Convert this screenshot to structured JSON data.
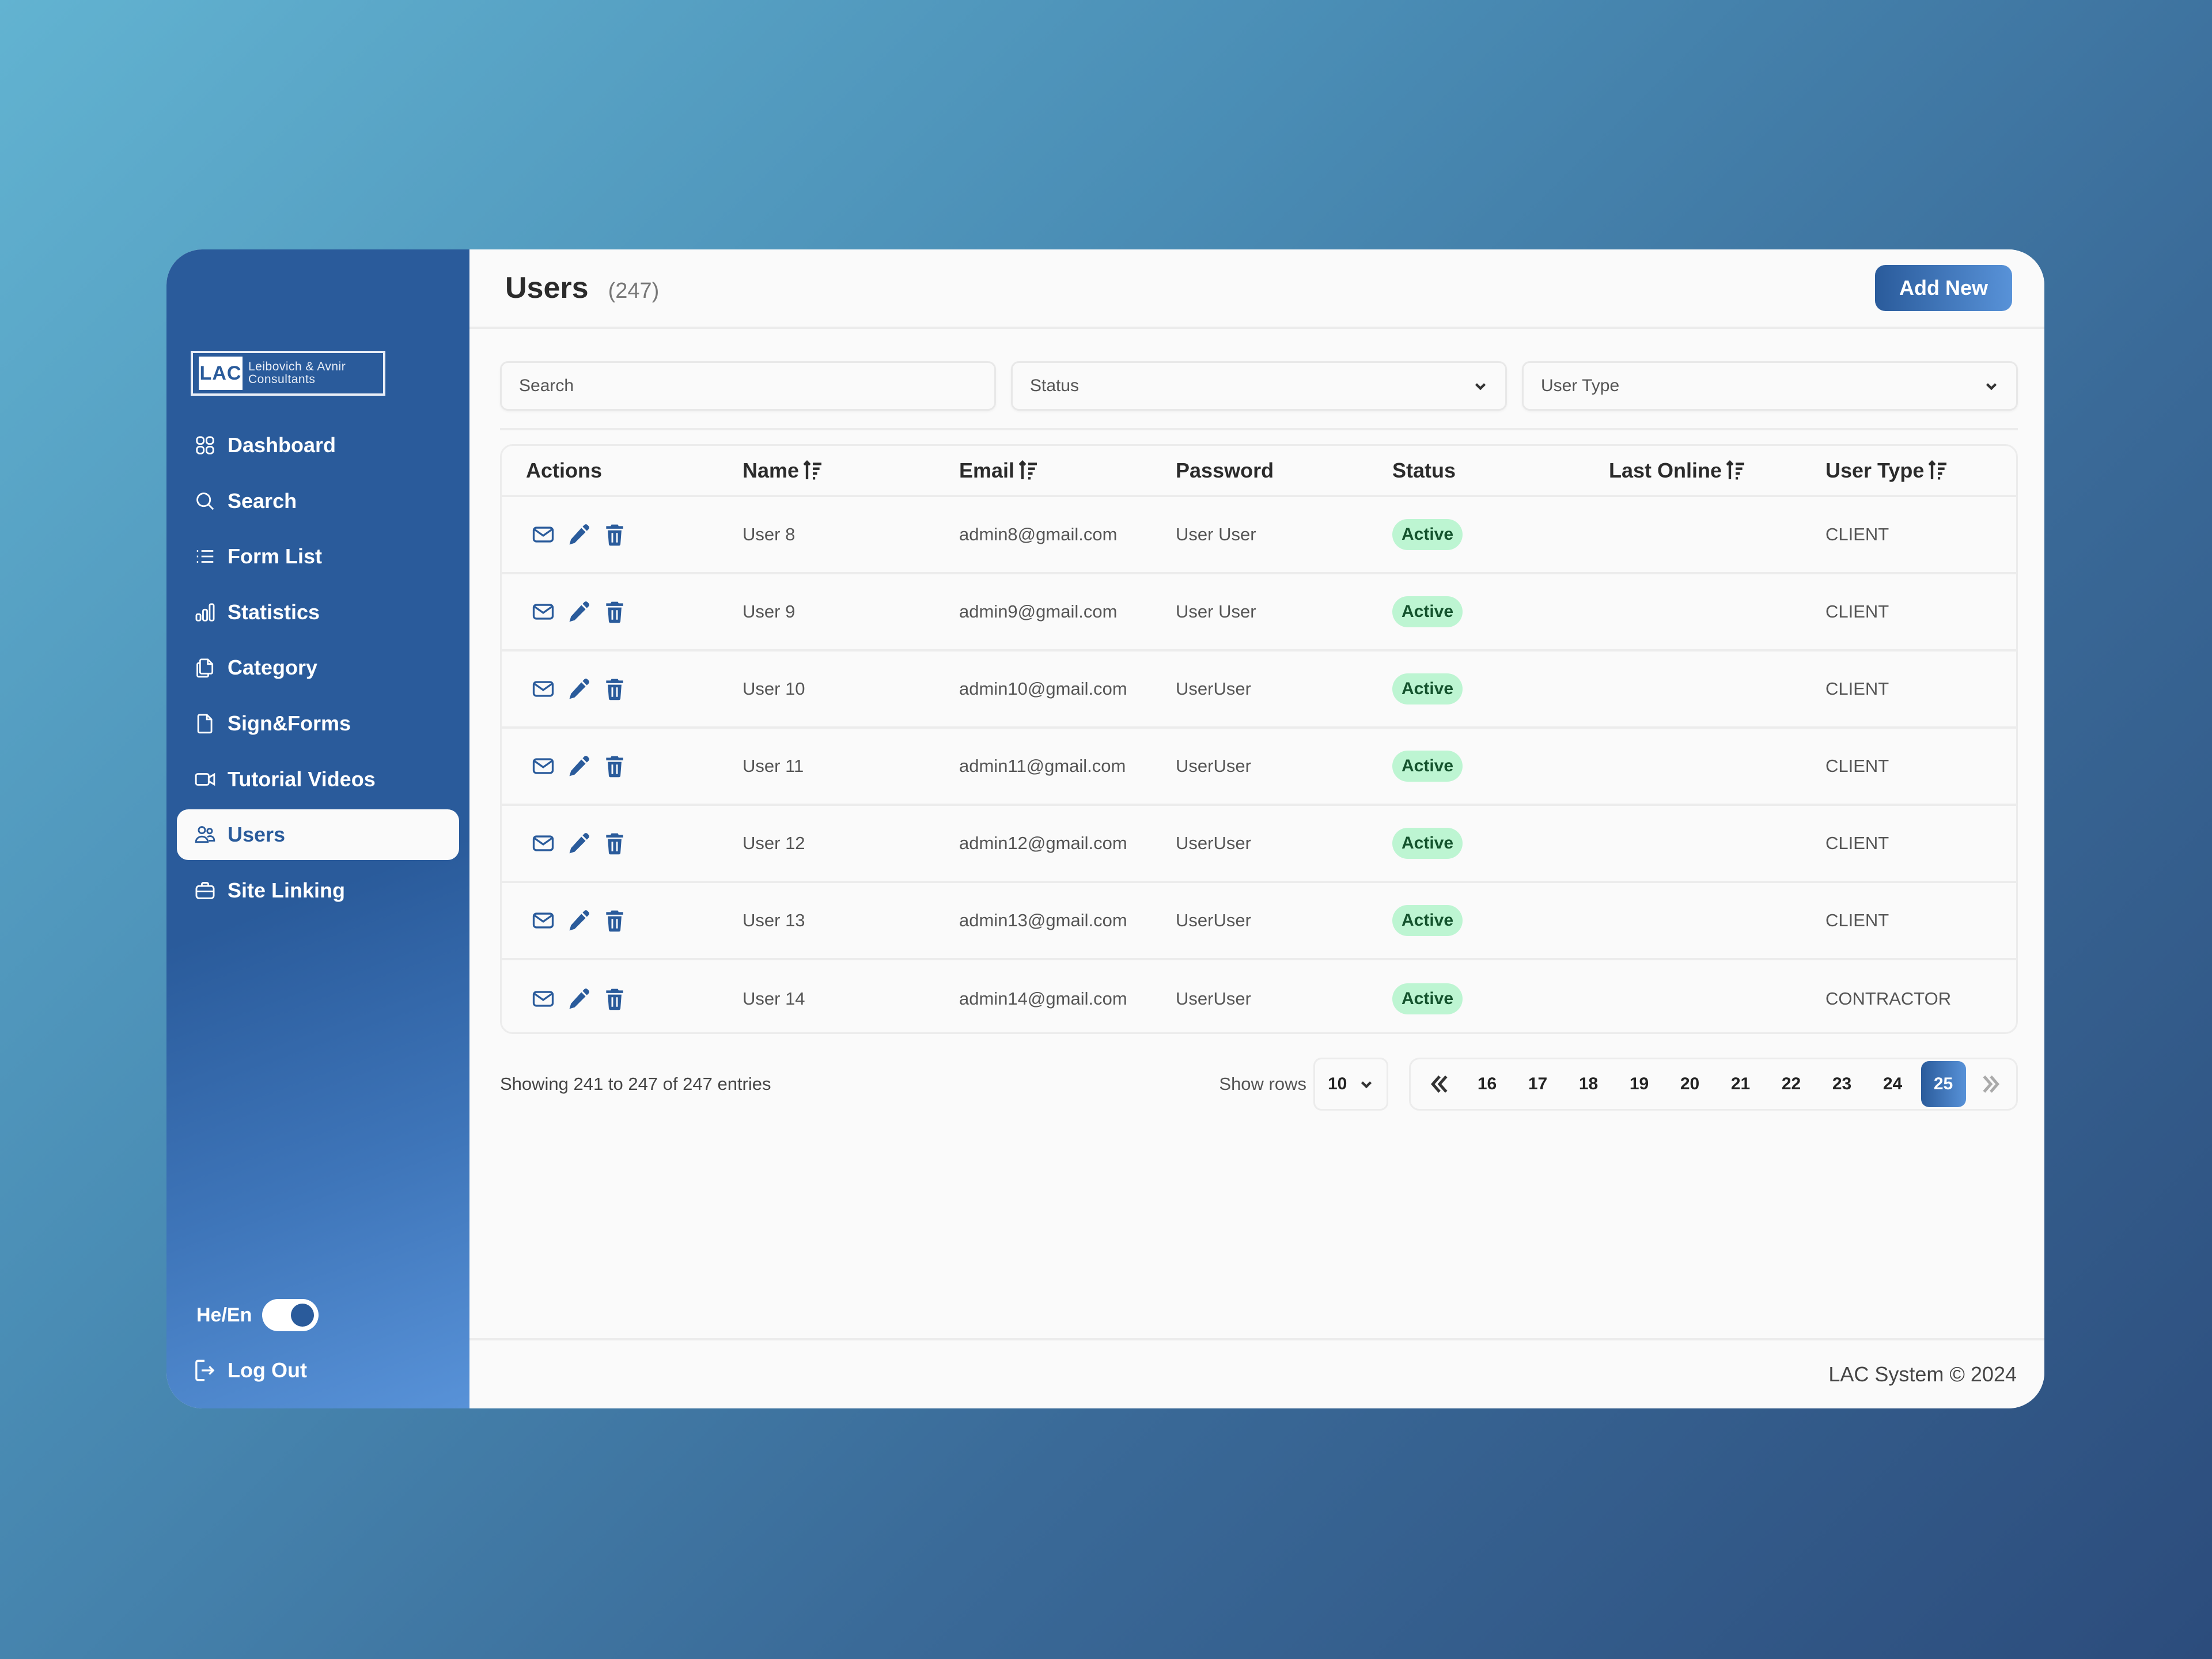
{
  "sidebar": {
    "logo": {
      "mark": "LAC",
      "line1": "Leibovich & Avnir",
      "line2": "Consultants"
    },
    "items": [
      {
        "label": "Dashboard",
        "icon": "dashboard-grid-icon",
        "active": false
      },
      {
        "label": "Search",
        "icon": "search-icon",
        "active": false
      },
      {
        "label": "Form List",
        "icon": "list-icon",
        "active": false
      },
      {
        "label": "Statistics",
        "icon": "bar-chart-icon",
        "active": false
      },
      {
        "label": "Category",
        "icon": "copy-documents-icon",
        "active": false
      },
      {
        "label": "Sign&Forms",
        "icon": "document-icon",
        "active": false
      },
      {
        "label": "Tutorial Videos",
        "icon": "video-camera-icon",
        "active": false
      },
      {
        "label": "Users",
        "icon": "users-icon",
        "active": true
      },
      {
        "label": "Site Linking",
        "icon": "briefcase-icon",
        "active": false
      }
    ],
    "language_toggle": {
      "label": "He/En",
      "on": true
    },
    "logout_label": "Log Out"
  },
  "header": {
    "title": "Users",
    "count": "(247)",
    "add_button": "Add New"
  },
  "filters": {
    "search_placeholder": "Search",
    "status_value": "Status",
    "user_type_value": "User Type"
  },
  "table": {
    "columns": [
      {
        "label": "Actions",
        "sortable": false
      },
      {
        "label": "Name",
        "sortable": true
      },
      {
        "label": "Email",
        "sortable": true
      },
      {
        "label": "Password",
        "sortable": false
      },
      {
        "label": "Status",
        "sortable": false
      },
      {
        "label": "Last Online",
        "sortable": true
      },
      {
        "label": "User Type",
        "sortable": true
      }
    ],
    "rows": [
      {
        "name": "User 8",
        "email": "admin8@gmail.com",
        "password": "User User",
        "status": "Active",
        "last_online": "",
        "user_type": "CLIENT"
      },
      {
        "name": "User 9",
        "email": "admin9@gmail.com",
        "password": "User User",
        "status": "Active",
        "last_online": "",
        "user_type": "CLIENT"
      },
      {
        "name": "User 10",
        "email": "admin10@gmail.com",
        "password": "UserUser",
        "status": "Active",
        "last_online": "",
        "user_type": "CLIENT"
      },
      {
        "name": "User 11",
        "email": "admin11@gmail.com",
        "password": "UserUser",
        "status": "Active",
        "last_online": "",
        "user_type": "CLIENT"
      },
      {
        "name": "User 12",
        "email": "admin12@gmail.com",
        "password": "UserUser",
        "status": "Active",
        "last_online": "",
        "user_type": "CLIENT"
      },
      {
        "name": "User 13",
        "email": "admin13@gmail.com",
        "password": "UserUser",
        "status": "Active",
        "last_online": "",
        "user_type": "CLIENT"
      },
      {
        "name": "User 14",
        "email": "admin14@gmail.com",
        "password": "UserUser",
        "status": "Active",
        "last_online": "",
        "user_type": "CONTRACTOR"
      }
    ]
  },
  "pagination": {
    "showing": "Showing 241 to 247 of 247 entries",
    "show_rows_label": "Show rows",
    "rows_per_page": "10",
    "pages": [
      "16",
      "17",
      "18",
      "19",
      "20",
      "21",
      "22",
      "23",
      "24",
      "25"
    ],
    "current_page": "25"
  },
  "footer": {
    "text": "LAC System © 2024"
  },
  "colors": {
    "primary": "#2a5b9b",
    "primary_light": "#5892d8",
    "active_badge_bg": "#bdf5d2",
    "active_badge_text": "#14532d"
  }
}
